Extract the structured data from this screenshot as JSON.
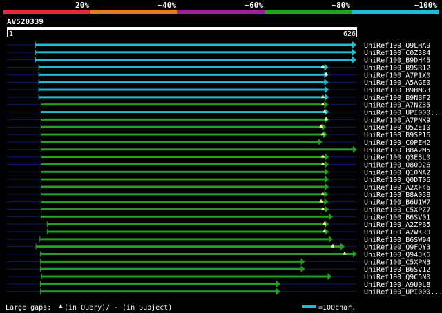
{
  "chart_data": {
    "type": "alignment",
    "identity_scale": {
      "labels": [
        "20%",
        "~40%",
        "~60%",
        "~80%",
        "~100%"
      ],
      "colors": [
        "#e8273a",
        "#e87a22",
        "#992299",
        "#22a022",
        "#22bbcc"
      ]
    },
    "query": {
      "id": "AV520339",
      "start": "1",
      "end": "626",
      "length": 626
    },
    "hits": [
      {
        "id": "UniRef100_Q9LHA9",
        "start": 52,
        "end": 626,
        "color": "#22bbcc"
      },
      {
        "id": "UniRef100_C0Z384",
        "start": 52,
        "end": 626,
        "color": "#22bbcc"
      },
      {
        "id": "UniRef100_B9DH45",
        "start": 52,
        "end": 626,
        "color": "#22bbcc"
      },
      {
        "id": "UniRef100_B9SR12",
        "start": 58,
        "end": 576,
        "color": "#22bbcc",
        "gap": 566
      },
      {
        "id": "UniRef100_A7PIX0",
        "start": 58,
        "end": 576,
        "color": "#22bbcc",
        "gap": 572
      },
      {
        "id": "UniRef100_A5AGE0",
        "start": 58,
        "end": 576,
        "color": "#22bbcc"
      },
      {
        "id": "UniRef100_B9HMG3",
        "start": 58,
        "end": 577,
        "color": "#22bbcc"
      },
      {
        "id": "UniRef100_B9NBF2",
        "start": 58,
        "end": 577,
        "color": "#22bbcc",
        "gap": 566
      },
      {
        "id": "UniRef100_A7NZ35",
        "start": 62,
        "end": 576,
        "color": "#22a022",
        "gap": 566
      },
      {
        "id": "UniRef100_UPI000...",
        "start": 62,
        "end": 577,
        "color": "#22bbcc",
        "gap": 569
      },
      {
        "id": "UniRef100_A7PNK9",
        "start": 62,
        "end": 577,
        "color": "#22a022",
        "gap": 572
      },
      {
        "id": "UniRef100_Q5ZEI0",
        "start": 62,
        "end": 572,
        "color": "#22a022",
        "gap": 563
      },
      {
        "id": "UniRef100_B9SP16",
        "start": 62,
        "end": 574,
        "color": "#22a022",
        "gap": 566
      },
      {
        "id": "UniRef100_C0PEH2",
        "start": 62,
        "end": 565,
        "color": "#22a022"
      },
      {
        "id": "UniRef100_B8A2M5",
        "start": 62,
        "end": 627,
        "color": "#22a022"
      },
      {
        "id": "UniRef100_Q3EBL0",
        "start": 62,
        "end": 577,
        "color": "#22a022",
        "gap": 566
      },
      {
        "id": "UniRef100_O80926",
        "start": 62,
        "end": 577,
        "color": "#22a022",
        "gap": 566
      },
      {
        "id": "UniRef100_Q10NA2",
        "start": 62,
        "end": 577,
        "color": "#22a022"
      },
      {
        "id": "UniRef100_Q0DT06",
        "start": 62,
        "end": 577,
        "color": "#22a022"
      },
      {
        "id": "UniRef100_A2XF46",
        "start": 62,
        "end": 577,
        "color": "#22a022"
      },
      {
        "id": "UniRef100_B8A038",
        "start": 62,
        "end": 576,
        "color": "#22a022",
        "gap": 566
      },
      {
        "id": "UniRef100_B6U1W7",
        "start": 62,
        "end": 576,
        "color": "#22a022",
        "gap": 563
      },
      {
        "id": "UniRef100_C5XPZ7",
        "start": 62,
        "end": 577,
        "color": "#22a022",
        "gap": 566
      },
      {
        "id": "UniRef100_B6SV01",
        "start": 62,
        "end": 584,
        "color": "#22a022"
      },
      {
        "id": "UniRef100_A2ZPB5",
        "start": 73,
        "end": 577,
        "color": "#22a022",
        "gap": 569
      },
      {
        "id": "UniRef100_A2WKR0",
        "start": 73,
        "end": 577,
        "color": "#22a022",
        "gap": 569
      },
      {
        "id": "UniRef100_B6SW94",
        "start": 60,
        "end": 584,
        "color": "#22a022"
      },
      {
        "id": "UniRef100_Q9FQY3",
        "start": 53,
        "end": 605,
        "color": "#22a022",
        "gap": 584
      },
      {
        "id": "UniRef100_Q943K6",
        "start": 61,
        "end": 627,
        "color": "#22a022",
        "gap": 605
      },
      {
        "id": "UniRef100_C5XPN3",
        "start": 61,
        "end": 534,
        "color": "#22a022"
      },
      {
        "id": "UniRef100_B6SV12",
        "start": 61,
        "end": 534,
        "color": "#22a022"
      },
      {
        "id": "UniRef100_Q9C5N0",
        "start": 63,
        "end": 582,
        "color": "#22a022"
      },
      {
        "id": "UniRef100_A9U0L8",
        "start": 61,
        "end": 490,
        "color": "#22a022"
      },
      {
        "id": "UniRef100_UPI000...",
        "start": 61,
        "end": 490,
        "color": "#22a022"
      }
    ]
  },
  "legend": {
    "gaps_label": "Large gaps:",
    "query_label": "(in Query)/",
    "subject_label": "- (in Subject)",
    "scale_label": "=100char.",
    "scale_chars": 100,
    "scale_color": "#22bbcc"
  }
}
